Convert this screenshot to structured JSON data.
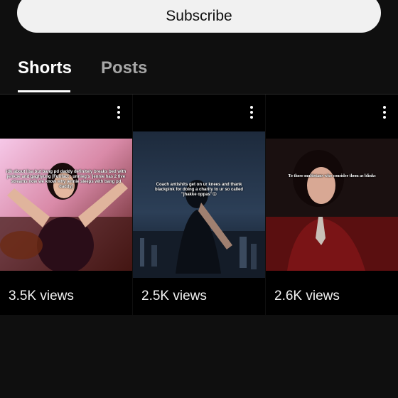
{
  "subscribe": {
    "label": "Subscribe"
  },
  "tabs": [
    {
      "label": "Shorts",
      "active": true
    },
    {
      "label": "Posts",
      "active": false
    }
  ],
  "shorts": [
    {
      "caption": "idk about lisa but bang pd daddy definitely breaks bed with jenkoe and gaghyung [Funfact : unnieg's 'jennie has 2 five streams now we know why jennie sleeps with bang pd daddy]",
      "views": "3.5K views"
    },
    {
      "caption": "Coach antishits get on ur knees and thank blackpink for doing a charity to ur so called \"jhakke oppas\"😡",
      "views": "2.5K views"
    },
    {
      "caption": "To those multistans who consider them as blinks",
      "views": "2.6K views"
    }
  ],
  "icons": {
    "more": "more-vert-icon"
  },
  "colors": {
    "background": "#0f0f0f",
    "button": "#f1f1f1",
    "active_tab": "#ffffff",
    "inactive_tab": "#a7a7a7"
  }
}
